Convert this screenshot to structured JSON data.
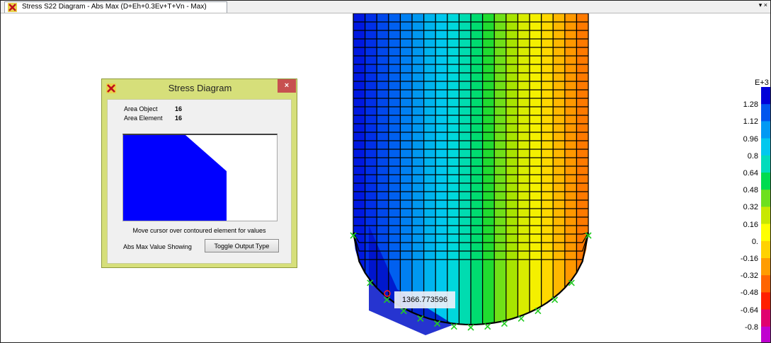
{
  "window": {
    "tab_title": "Stress S22 Diagram - Abs Max  (D+Eh+0.3Ev+T+Vn - Max)",
    "tab_icon": "sap2000-icon",
    "tab_menu_glyph": "▾ ×"
  },
  "legend": {
    "exponent": "E+3",
    "labels": [
      "1.28",
      "1.12",
      "0.96",
      "0.8",
      "0.64",
      "0.48",
      "0.32",
      "0.16",
      "0.",
      "-0.16",
      "-0.32",
      "-0.48",
      "-0.64",
      "-0.8"
    ],
    "colors": [
      "#0000d8",
      "#0055ee",
      "#0099f4",
      "#00c8ee",
      "#00dcbc",
      "#00dc50",
      "#6ee01e",
      "#c8e800",
      "#ffff00",
      "#ffd200",
      "#ff9c00",
      "#ff6400",
      "#ff2000",
      "#e00070",
      "#c000d0"
    ]
  },
  "value_tooltip": {
    "text": "1366.773596"
  },
  "dialog": {
    "title": "Stress Diagram",
    "close_glyph": "×",
    "area_object_label": "Area Object",
    "area_object_value": "16",
    "area_element_label": "Area Element",
    "area_element_value": "16",
    "hint": "Move cursor over contoured element for values",
    "mode_label": "Abs Max Value Showing",
    "toggle_button": "Toggle Output Type",
    "fill_color": "#0000ff"
  }
}
